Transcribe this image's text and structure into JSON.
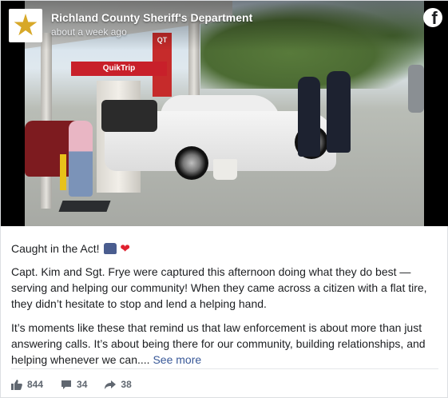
{
  "header": {
    "page_name": "Richland County Sheriff's Department",
    "timestamp": "about a week ago",
    "logo_icon": "sheriff-star-badge-icon",
    "platform_icon": "facebook-icon"
  },
  "photo": {
    "signs": {
      "qt_sign": "QT",
      "banner": "QuikTrip"
    }
  },
  "post": {
    "headline": "Caught in the Act!",
    "headline_emojis": [
      "police-car-icon",
      "heart-icon"
    ],
    "paragraph_1": "Capt. Kim and Sgt. Frye were captured this afternoon doing what they do best — serving and helping our community! When they came across a citizen with a flat tire, they didn’t hesitate to stop and lend a helping hand.",
    "paragraph_2": "It’s moments like these that remind us that law enforcement is about more than just answering calls. It’s about being there for our community, building relationships, and helping whenever we can....",
    "see_more": "See more"
  },
  "stats": {
    "likes": "844",
    "comments": "34",
    "shares": "38",
    "like_icon": "thumbs-up-icon",
    "comment_icon": "comment-bubble-icon",
    "share_icon": "share-arrow-icon"
  },
  "colors": {
    "link": "#385898",
    "muted": "#606770",
    "text": "#1c1e21",
    "heart": "#e0212f"
  }
}
